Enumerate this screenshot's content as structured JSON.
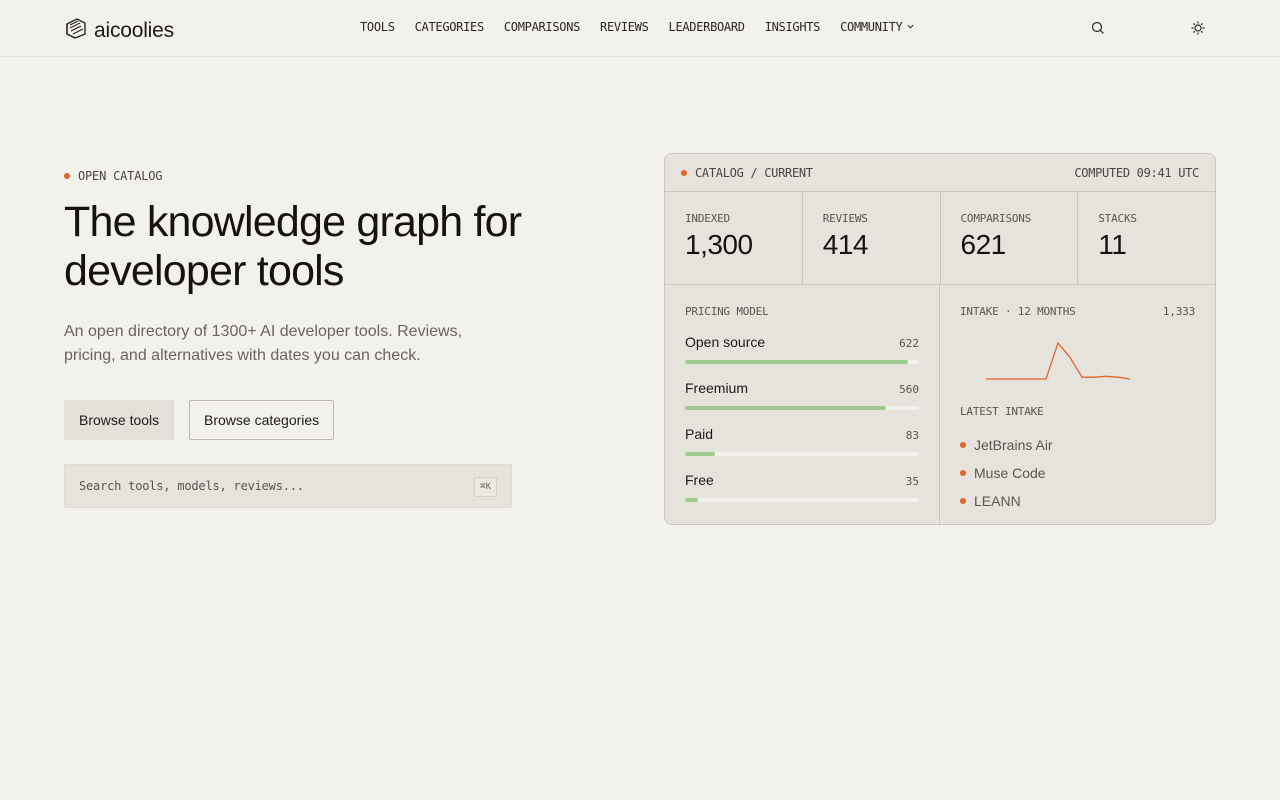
{
  "header": {
    "brand": "aicoolies",
    "nav": [
      {
        "label": "TOOLS"
      },
      {
        "label": "CATEGORIES"
      },
      {
        "label": "COMPARISONS"
      },
      {
        "label": "REVIEWS"
      },
      {
        "label": "LEADERBOARD"
      },
      {
        "label": "INSIGHTS"
      },
      {
        "label": "COMMUNITY",
        "has_dropdown": true
      }
    ],
    "icons": [
      "search-icon",
      "sun-icon"
    ]
  },
  "hero": {
    "eyebrow": "OPEN CATALOG",
    "title": "The knowledge graph for developer tools",
    "subtitle": "An open directory of 1300+ AI developer tools. Reviews, pricing, and alternatives with dates you can check.",
    "primary_button": "Browse tools",
    "secondary_button": "Browse categories",
    "search_placeholder": "Search tools, models, reviews...",
    "search_shortcut": "⌘K",
    "accent_color": "#e0652a"
  },
  "card": {
    "title": "CATALOG / CURRENT",
    "computed": "COMPUTED 09:41 UTC",
    "stats": [
      {
        "label": "INDEXED",
        "value": "1,300"
      },
      {
        "label": "REVIEWS",
        "value": "414"
      },
      {
        "label": "COMPARISONS",
        "value": "621"
      },
      {
        "label": "STACKS",
        "value": "11"
      }
    ],
    "pricing": {
      "label": "PRICING MODEL",
      "max": 622,
      "bar_color": "#9ccb8b",
      "rows": [
        {
          "name": "Open source",
          "count": 622
        },
        {
          "name": "Freemium",
          "count": 560
        },
        {
          "name": "Paid",
          "count": 83
        },
        {
          "name": "Free",
          "count": 35
        }
      ]
    },
    "intake": {
      "label": "INTAKE · 12 MONTHS",
      "total": "1,333",
      "line_color": "#e0652a",
      "values": [
        0,
        0,
        0,
        0,
        0,
        0,
        40,
        24,
        2,
        2,
        3,
        2,
        0
      ]
    },
    "latest": {
      "label": "LATEST INTAKE",
      "items": [
        "JetBrains Air",
        "Muse Code",
        "LEANN"
      ]
    }
  }
}
